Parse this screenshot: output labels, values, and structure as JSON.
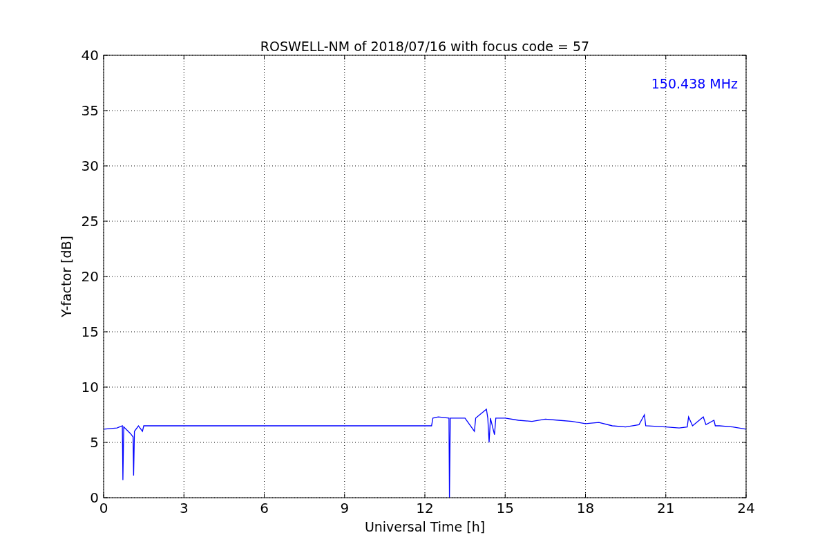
{
  "chart_data": {
    "type": "line",
    "title": "ROSWELL-NM of 2018/07/16 with focus code = 57",
    "xlabel": "Universal Time [h]",
    "ylabel": "Y-factor [dB]",
    "x": [
      0,
      0.5,
      0.7,
      0.72,
      0.75,
      1.0,
      1.1,
      1.12,
      1.15,
      1.3,
      1.45,
      1.5,
      12.25,
      12.3,
      12.5,
      12.9,
      12.92,
      12.95,
      13.5,
      13.85,
      13.9,
      14.3,
      14.35,
      14.4,
      14.45,
      14.6,
      14.65,
      15,
      15.5,
      16,
      16.5,
      17,
      17.5,
      18,
      18.5,
      19,
      19.5,
      20,
      20.2,
      20.25,
      21,
      21.5,
      21.8,
      21.85,
      22,
      22.4,
      22.5,
      22.8,
      22.85,
      23,
      23.5,
      24
    ],
    "series": [
      {
        "name": "150.438 MHz",
        "color": "#0000ff",
        "values": [
          6.2,
          6.3,
          6.5,
          1.6,
          6.4,
          5.8,
          5.5,
          2.0,
          6.0,
          6.5,
          6.0,
          6.5,
          6.5,
          7.2,
          7.3,
          7.2,
          0,
          7.2,
          7.2,
          6.0,
          7.2,
          8.0,
          7.2,
          5.0,
          7.2,
          5.7,
          7.2,
          7.2,
          7.0,
          6.9,
          7.1,
          7.0,
          6.9,
          6.7,
          6.8,
          6.5,
          6.4,
          6.6,
          7.5,
          6.5,
          6.4,
          6.3,
          6.4,
          7.3,
          6.5,
          7.3,
          6.6,
          7.0,
          6.5,
          6.5,
          6.4,
          6.2
        ]
      }
    ],
    "grid": true,
    "xlim": [
      0,
      24
    ],
    "ylim": [
      0,
      40
    ],
    "xticks": [
      0,
      3,
      6,
      9,
      12,
      15,
      18,
      21,
      24
    ],
    "yticks": [
      0,
      5,
      10,
      15,
      20,
      25,
      30,
      35,
      40
    ]
  }
}
